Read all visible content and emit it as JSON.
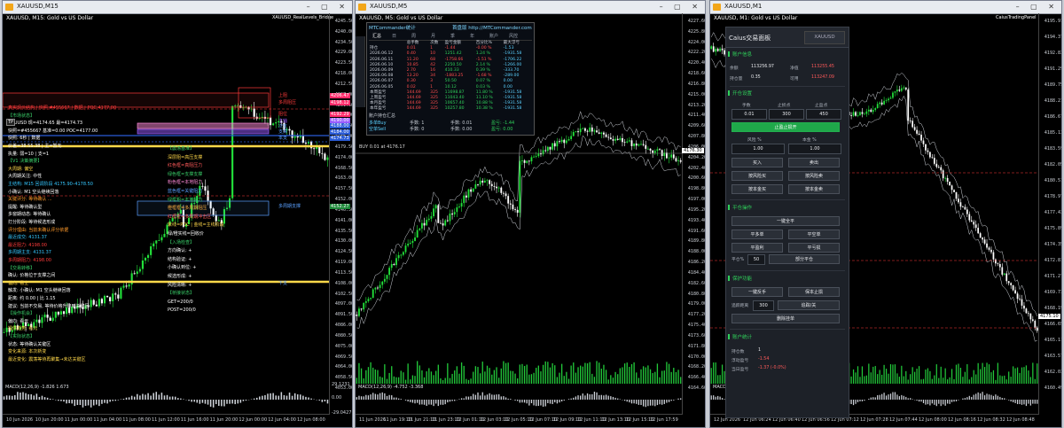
{
  "windows": [
    {
      "title": "XAUUSD,M15",
      "symbol_line": "XAUUSD, M15:  Gold vs US Dollar",
      "indicator_badge": "XAUUSD_RealLevels_Bridge",
      "price_labels": [
        "4245.50",
        "4240.00",
        "4234.50",
        "4229.00",
        "4223.50",
        "4218.00",
        "4212.50",
        "4207.00",
        "4201.50",
        "4196.00",
        "4190.50",
        "4185.00",
        "4179.50",
        "4174.00",
        "4168.50",
        "4163.00",
        "4157.50",
        "4152.00",
        "4146.50",
        "4141.00",
        "4135.50",
        "4130.00",
        "4124.50",
        "4119.00",
        "4113.50",
        "4108.00",
        "4102.50",
        "4097.00",
        "4091.50",
        "4086.00",
        "4080.50",
        "4075.00",
        "4069.50",
        "4064.00",
        "4058.50",
        "4053.00"
      ],
      "time_labels": [
        "10 Jun 2026",
        "10 Jun 20:00",
        "11 Jun 00:00",
        "11 Jun 04:00",
        "11 Jun 08:00",
        "11 Jun 12:00",
        "11 Jun 16:00",
        "11 Jun 20:00",
        "12 Jun 00:00",
        "12 Jun 04:00",
        "12 Jun 08:00"
      ],
      "macd_label": "MACD(12,26,9) -1.826 1.673",
      "macd_scale": [
        "29.1231",
        "0.00",
        "-29.0427"
      ],
      "level_badges": [
        {
          "text": "4206.47",
          "color": "#ff2a6a"
        },
        {
          "text": "4198.12",
          "color": "#ff2a6a"
        },
        {
          "text": "4192.29",
          "color": "#ff2a6a"
        },
        {
          "text": "4190.00",
          "color": "#9a5cff"
        },
        {
          "text": "4188.00",
          "color": "#2a5bd6"
        },
        {
          "text": "4184.00",
          "color": "#2a5bd6"
        },
        {
          "text": "4174.73",
          "color": "#2a5bd6"
        },
        {
          "text": "4152.27",
          "color": "#1e8a3a"
        }
      ],
      "overlay_lines": [
        {
          "text": "真实现价结构 | 快照 #455667 | 数据 | POC 4177.00",
          "color": "#ff3b3b"
        },
        {
          "text": "【市场状态】",
          "color": "#3ad06a"
        },
        {
          "text": "XAUUSD 现=4174.65 最=4174.73",
          "color": "#ffffff"
        },
        {
          "text": "快照=#455667 基准=0.00 POC=4177.00",
          "color": "#ffffff"
        },
        {
          "text": "快照: 6秒 | 数据",
          "color": "#ffffff"
        },
        {
          "text": "价差=38.55.38 | 主=暂无",
          "color": "#ffffff"
        },
        {
          "text": "执量: 弱=10 | 支=1",
          "color": "#ffffff"
        },
        {
          "text": "【V1 决策摘要】",
          "color": "#3ad06a"
        },
        {
          "text": "大周期: 偏空",
          "color": "#ffd84a"
        },
        {
          "text": "大周期关注: 中性",
          "color": "#ffffff"
        },
        {
          "text": "主结构: M15 回调阶段 4175.90–4178.50",
          "color": "#35c7ff"
        },
        {
          "text": "小确认: M1 空头继续回落",
          "color": "#ffffff"
        },
        {
          "text": "关键评分: 等待确认 ...",
          "color": "#ff9a2a"
        },
        {
          "text": "提醒: 等待确认型",
          "color": "#ffffff"
        },
        {
          "text": "多窗期动态: 等待确认",
          "color": "#ffffff"
        },
        {
          "text": "打分阶段: 等待候选形成",
          "color": "#ffffff"
        },
        {
          "text": "评分理由: 当前未确认评分依据",
          "color": "#ff9a2a"
        },
        {
          "text": "最近成交: 4131.37",
          "color": "#35c7ff"
        },
        {
          "text": "最近阻力: 4198.00",
          "color": "#ff3b3b"
        },
        {
          "text": "多周期主支: 4131.37",
          "color": "#35c7ff"
        },
        {
          "text": "多周期阻力: 4198.00",
          "color": "#ff3b3b"
        },
        {
          "text": "【交易转移】",
          "color": "#3ad06a"
        },
        {
          "text": "确认: 价格位于支撑之间",
          "color": "#ffffff"
        },
        {
          "text": "偏向: 看空",
          "color": "#ffd84a"
        },
        {
          "text": "触发: 小确认: M1 空头继续回落",
          "color": "#ffffff"
        },
        {
          "text": "距离: 约 0.00 | 比 1.15",
          "color": "#ffffff"
        },
        {
          "text": "建议: 当前不交易, 等待价格升降到关键区",
          "color": "#ffffff"
        },
        {
          "text": "【操作机会】",
          "color": "#3ad06a"
        },
        {
          "text": "偏向: 看元",
          "color": "#ffffff"
        },
        {
          "text": "提供趋势: 看元",
          "color": "#ffd84a"
        },
        {
          "text": "【实际状态】",
          "color": "#3ad06a"
        },
        {
          "text": "状态: 等待确认关键区",
          "color": "#ffffff"
        },
        {
          "text": "变化来源: 本次新变",
          "color": "#ffd84a"
        },
        {
          "text": "最近变化: 震荡等待再聚集→未达关键区",
          "color": "#ffd84a"
        }
      ],
      "right_overlay": [
        {
          "text": "【震荡基准】",
          "color": "#3ad06a"
        },
        {
          "text": "深层阻=高压支撑",
          "color": "#ffd84a"
        },
        {
          "text": "红色框=真阻压力",
          "color": "#ff5a5a"
        },
        {
          "text": "绿色框=支撑支撑",
          "color": "#3ad06a"
        },
        {
          "text": "粉色框=本地阻力",
          "color": "#ff8ad8"
        },
        {
          "text": "蓝色框=关键阻力",
          "color": "#5aa0ff"
        },
        {
          "text": "绿框粗=本地阻力",
          "color": "#3ad06a"
        },
        {
          "text": "橙框框=多周期阻压",
          "color": "#ffb040"
        },
        {
          "text": "红框框=多周期冲击区",
          "color": "#ff5a5a"
        },
        {
          "text": "紫线=POC | 金线=主线阶段",
          "color": "#ffd84a"
        },
        {
          "text": "绿/橙实线=回收价",
          "color": "#ffffff"
        },
        {
          "text": "【入场检查】",
          "color": "#3ad06a"
        },
        {
          "text": "方向确认: +",
          "color": "#ffffff"
        },
        {
          "text": "结构验证: +",
          "color": "#ffffff"
        },
        {
          "text": "小确认到位: +",
          "color": "#ffffff"
        },
        {
          "text": "候选形成: +",
          "color": "#ffffff"
        },
        {
          "text": "风险清晰: +",
          "color": "#ffffff"
        },
        {
          "text": "【桥接状态】",
          "color": "#3ad06a"
        },
        {
          "text": "GET=200/0",
          "color": "#ffffff"
        },
        {
          "text": "POST=200/0",
          "color": "#ffffff"
        }
      ],
      "zone_labels": [
        {
          "text": "上阻",
          "color": "#ff3b3b"
        },
        {
          "text": "多周阻压",
          "color": "#ff3b3b"
        },
        {
          "text": "阻位",
          "color": "#ff3b3b"
        },
        {
          "text": "主轴",
          "color": "#9a5cff"
        },
        {
          "text": "次支",
          "color": "#5aa0ff"
        },
        {
          "text": "支撑",
          "color": "#5aa0ff"
        },
        {
          "text": "本支",
          "color": "#5aa0ff"
        },
        {
          "text": "多周期支撑",
          "color": "#5aa0ff"
        },
        {
          "text": "下支",
          "color": "#5aa0ff"
        }
      ],
      "tp_label": "TP"
    },
    {
      "title": "XAUUSD,M5",
      "symbol_line": "XAUUSD, M5:  Gold vs US Dollar",
      "price_labels": [
        "4227.60",
        "4225.80",
        "4224.00",
        "4222.20",
        "4220.40",
        "4218.60",
        "4216.80",
        "4215.00",
        "4213.20",
        "4211.40",
        "4209.60",
        "4207.80",
        "4206.00",
        "4204.20",
        "4202.40",
        "4200.60",
        "4198.80",
        "4197.00",
        "4195.20",
        "4193.40",
        "4191.60",
        "4189.80",
        "4188.00",
        "4186.20",
        "4184.40",
        "4182.60",
        "4180.80",
        "4179.00",
        "4177.20",
        "4175.40",
        "4173.60",
        "4171.80",
        "4170.00",
        "4168.20",
        "4166.40",
        "4164.60"
      ],
      "time_labels": [
        "11 Jun 2026",
        "11 Jun 19:10",
        "11 Jun 21:10",
        "11 Jun 23:10",
        "12 Jun 01:10",
        "12 Jun 03:10",
        "12 Jun 05:10",
        "12 Jun 07:10",
        "12 Jun 09:10",
        "12 Jun 11:10",
        "12 Jun 13:10",
        "12 Jun 15:10",
        "12 Jun 17:59"
      ],
      "macd_label": "MACD(12,26,9) -4.752 -3.368",
      "current_price_badge": "4176.30",
      "bid_line": "BUY 0.01 at 4176.17",
      "stats_panel": {
        "title": "MTCommander统计",
        "link": "首盘版 http://MTCommander.com",
        "tabs": [
          "汇总",
          "日",
          "周",
          "月",
          "季",
          "年",
          "账户",
          "风控"
        ],
        "columns": [
          "",
          "总手数",
          "次数",
          "盈亏金额",
          "百分比%",
          "最大浮亏"
        ],
        "rows": [
          {
            "label": "持仓",
            "cells": [
              "0.01",
              "1",
              "-1.44",
              "-0.00 %",
              "-1.53"
            ],
            "tone": "r"
          },
          {
            "label": "2026.06.12",
            "cells": [
              "0.40",
              "10",
              "1251.42",
              "1.24 %",
              "-1931.58"
            ],
            "tone": "g"
          },
          {
            "label": "2026.06.11",
            "cells": [
              "11.20",
              "68",
              "-1758.66",
              "-1.51 %",
              "-1706.22"
            ],
            "tone": "r"
          },
          {
            "label": "2026.06.10",
            "cells": [
              "10.85",
              "42",
              "2250.50",
              "2.14 %",
              "-1266.00"
            ],
            "tone": "g"
          },
          {
            "label": "2026.06.09",
            "cells": [
              "2.70",
              "16",
              "410.33",
              "0.39 %",
              "-333.70"
            ],
            "tone": "g"
          },
          {
            "label": "2026.06.08",
            "cells": [
              "13.20",
              "34",
              "-1883.25",
              "-1.68 %",
              "-289.00"
            ],
            "tone": "r"
          },
          {
            "label": "2026.06.07",
            "cells": [
              "0.30",
              "3",
              "50.50",
              "0.07 %",
              "0.00"
            ],
            "tone": "g"
          },
          {
            "label": "2026.06.05",
            "cells": [
              "0.02",
              "1",
              "10.12",
              "0.03 %",
              "0.00"
            ],
            "tone": "g"
          },
          {
            "label": "本周盈亏",
            "cells": [
              "144.69",
              "325",
              "11698.87",
              "11.80 %",
              "-1931.58"
            ],
            "tone": "g"
          },
          {
            "label": "上周盈亏",
            "cells": [
              "144.69",
              "325",
              "11043.40",
              "11.10 %",
              "-1931.58"
            ],
            "tone": "g"
          },
          {
            "label": "本月盈亏",
            "cells": [
              "144.69",
              "325",
              "10657.40",
              "10.88 %",
              "-1931.58"
            ],
            "tone": "g"
          },
          {
            "label": "本年盈亏",
            "cells": [
              "144.69",
              "325",
              "10257.80",
              "10.38 %",
              "-1931.58"
            ],
            "tone": "g"
          }
        ],
        "summary_title": "账户持仓汇总",
        "summary_rows": [
          {
            "a": "多单Buy",
            "b": "手数: 1",
            "c": "手数: 0.01",
            "d": "盈亏: -1.44"
          },
          {
            "a": "空单Sell",
            "b": "手数: 0",
            "c": "手数: 0.00",
            "d": "盈亏: 0.00"
          }
        ]
      }
    },
    {
      "title": "XAUUSD,M1",
      "symbol_line": "XAUUSD, M1:  Gold vs US Dollar",
      "badge": "CaiusTradingPanel",
      "price_labels": [
        "4195.91",
        "4194.37",
        "4192.83",
        "4191.29",
        "4189.75",
        "4188.21",
        "4186.67",
        "4185.13",
        "4183.59",
        "4182.05",
        "4180.51",
        "4178.97",
        "4177.43",
        "4175.89",
        "4174.35",
        "4172.81",
        "4171.27",
        "4169.73",
        "4168.19",
        "4166.65",
        "4165.11",
        "4163.57",
        "4162.03",
        "4160.49"
      ],
      "time_labels": [
        "12 Jun 2026",
        "12 Jun 06:24",
        "12 Jun 06:40",
        "12 Jun 06:56",
        "12 Jun 07:12",
        "12 Jun 07:28",
        "12 Jun 07:44",
        "12 Jun 08:00",
        "12 Jun 08:16",
        "12 Jun 08:32",
        "12 Jun 08:48"
      ],
      "macd_label": "MACD(12,26,9) -2.696 -2.036",
      "current_price_badge": "4175.10",
      "trading_panel": {
        "title": "Caius交易面板",
        "symbol": "XAUUSD",
        "section_account": "账户信息",
        "account": [
          {
            "k": "余额",
            "v": "113256.97",
            "k2": "净值",
            "v2": "113255.45",
            "v2color": "#ff5a5a"
          },
          {
            "k": "持仓量",
            "v": "0.35",
            "k2": "可用",
            "v2": "113247.09",
            "v2color": "#ff5a5a"
          }
        ],
        "section_open": "开仓设置",
        "open_headers": [
          "手数",
          "止损点",
          "止盈点"
        ],
        "open_values": [
          "0.01",
          "300",
          "450"
        ],
        "green_button": "止盈止损开",
        "risk_headers": [
          "风险 %",
          "本金 %"
        ],
        "risk_values": [
          "1.00",
          "1.00"
        ],
        "buy_btn": "买入",
        "sell_btn": "卖出",
        "btn_grid": [
          "按风险买",
          "按风险卖",
          "按本金买",
          "按本金卖"
        ],
        "section_close": "平仓操作",
        "close_all": "一键全平",
        "close_grid": [
          "平多单",
          "平空单",
          "平盈利",
          "平亏损"
        ],
        "partial_label": "平仓%",
        "partial_value": "50",
        "partial_btn": "部分平仓",
        "section_protect": "保护功能",
        "protect_grid": [
          "一键反手",
          "保本止损"
        ],
        "trail_label": "追踪距离",
        "trail_value": "300",
        "trail_btn": "追踪/关",
        "delete_btn": "删除挂单",
        "section_stats": "账户统计",
        "stats": [
          {
            "k": "持仓数",
            "v": "1",
            "color": "#e5e7ea"
          },
          {
            "k": "浮动盈亏",
            "v": "-1.54",
            "color": "#ff5a5a"
          },
          {
            "k": "当日盈亏",
            "v": "-1.37 (-0.0%)",
            "color": "#ff5a5a"
          }
        ]
      }
    }
  ],
  "colors": {
    "candle_up": "#22e03a",
    "candle_down": "#ffffff",
    "accent_green": "#2fd05a",
    "accent_red": "#ff3b3b"
  }
}
